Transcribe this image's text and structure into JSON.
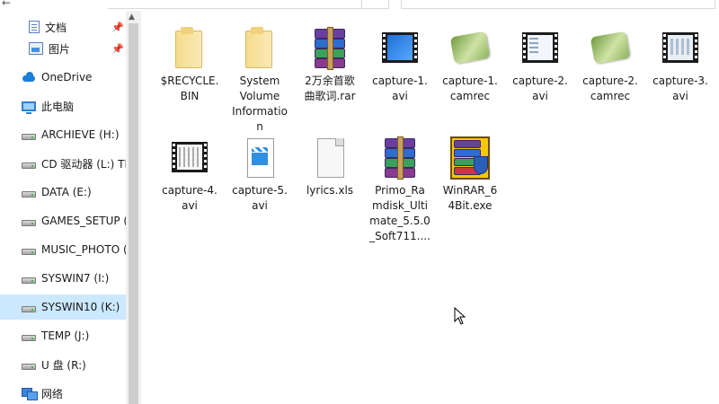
{
  "nav": {
    "items": [
      {
        "label": "文档",
        "icon": "document-icon",
        "pinned": true
      },
      {
        "label": "图片",
        "icon": "picture-icon",
        "pinned": true
      },
      {
        "label": "OneDrive",
        "icon": "cloud-icon"
      },
      {
        "label": "此电脑",
        "icon": "computer-icon"
      },
      {
        "label": "ARCHIEVE (H:)",
        "icon": "drive-icon"
      },
      {
        "label": "CD 驱动器 (L:) TP",
        "icon": "drive-icon"
      },
      {
        "label": "DATA (E:)",
        "icon": "drive-icon"
      },
      {
        "label": "GAMES_SETUP (",
        "icon": "drive-icon"
      },
      {
        "label": "MUSIC_PHOTO (",
        "icon": "drive-icon"
      },
      {
        "label": "SYSWIN7 (I:)",
        "icon": "drive-icon"
      },
      {
        "label": "SYSWIN10 (K:)",
        "icon": "drive-icon",
        "selected": true
      },
      {
        "label": "TEMP (J:)",
        "icon": "drive-icon"
      },
      {
        "label": "U 盘 (R:)",
        "icon": "drive-icon"
      },
      {
        "label": "网络",
        "icon": "network-icon"
      }
    ]
  },
  "files": [
    {
      "name": "$RECYCLE.BIN",
      "label_lines": [
        "$RECYCLE.",
        "BIN"
      ],
      "type": "folder"
    },
    {
      "name": "System Volume Information",
      "label_lines": [
        "System",
        "Volume",
        "Informatio",
        "n"
      ],
      "type": "folder"
    },
    {
      "name": "2万余首歌曲歌词.rar",
      "label_lines": [
        "2万余首歌",
        "曲歌词.rar"
      ],
      "type": "rar"
    },
    {
      "name": "capture-1.avi",
      "label_lines": [
        "capture-1.",
        "avi"
      ],
      "type": "video-blue"
    },
    {
      "name": "capture-1.camrec",
      "label_lines": [
        "capture-1.",
        "camrec"
      ],
      "type": "camrec"
    },
    {
      "name": "capture-2.avi",
      "label_lines": [
        "capture-2.",
        "avi"
      ],
      "type": "video-white"
    },
    {
      "name": "capture-2.camrec",
      "label_lines": [
        "capture-2.",
        "camrec"
      ],
      "type": "camrec"
    },
    {
      "name": "capture-3.avi",
      "label_lines": [
        "capture-3.",
        "avi"
      ],
      "type": "video-white2"
    },
    {
      "name": "capture-4.avi",
      "label_lines": [
        "capture-4.",
        "avi"
      ],
      "type": "video-grid"
    },
    {
      "name": "capture-5.avi",
      "label_lines": [
        "capture-5.",
        "avi"
      ],
      "type": "moviedoc"
    },
    {
      "name": "lyrics.xls",
      "label_lines": [
        "lyrics.xls"
      ],
      "type": "blank"
    },
    {
      "name": "Primo_Ramdisk_Ultimate_5.5.0_Soft711....",
      "label_lines": [
        "Primo_Ra",
        "mdisk_Ulti",
        "mate_5.5.0",
        "_Soft711...."
      ],
      "type": "rar"
    },
    {
      "name": "WinRAR_64Bit.exe",
      "label_lines": [
        "WinRAR_6",
        "4Bit.exe"
      ],
      "type": "winrar"
    }
  ]
}
